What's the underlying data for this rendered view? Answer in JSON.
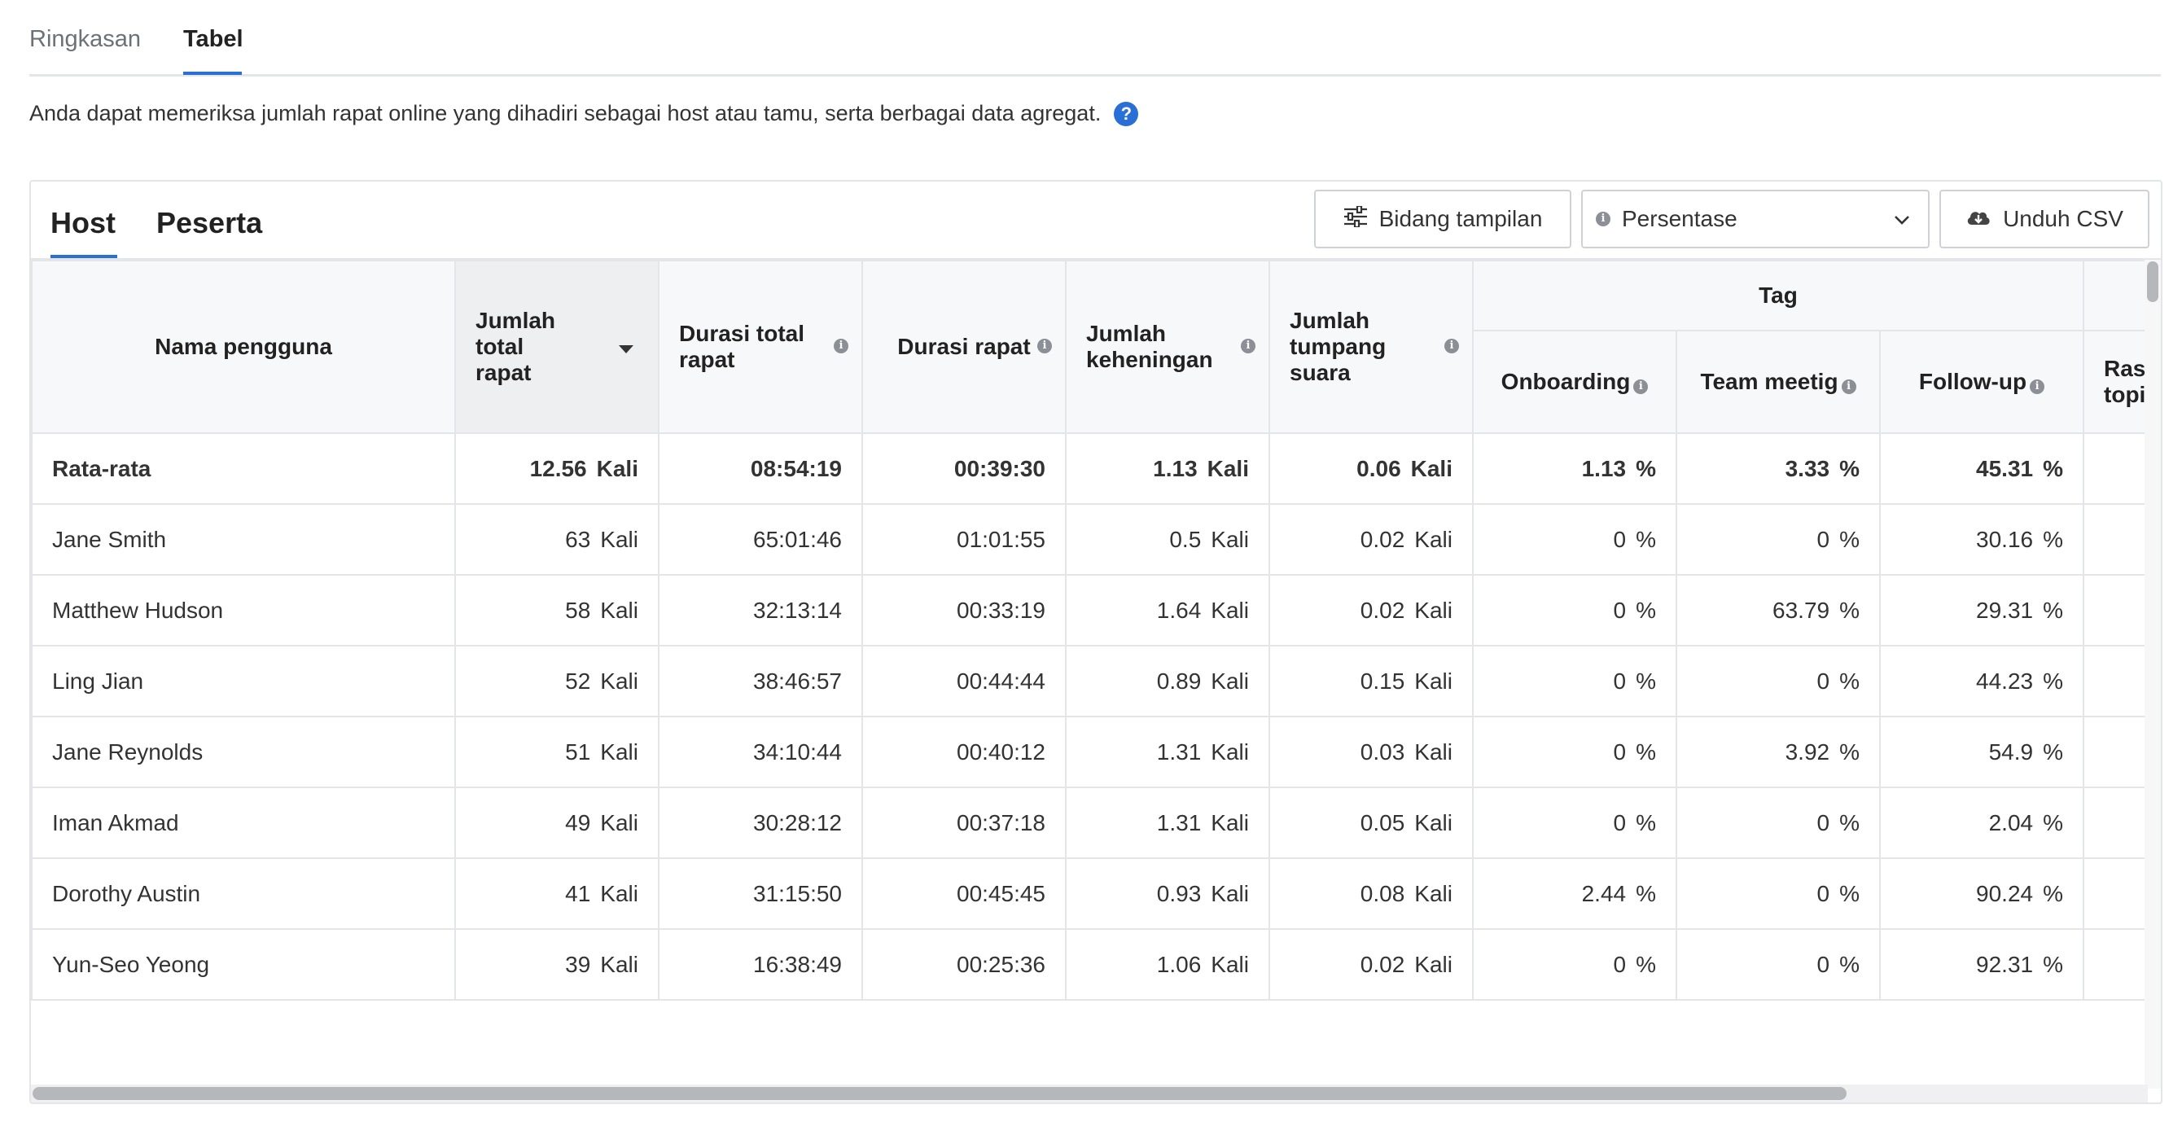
{
  "top_tabs": [
    "Ringkasan",
    "Tabel"
  ],
  "description": "Anda dapat memeriksa jumlah rapat online yang dihadiri sebagai host atau tamu, serta berbagai data agregat.",
  "panel_tabs": [
    "Host",
    "Peserta"
  ],
  "toolbar": {
    "fields_label": "Bidang tampilan",
    "percent_select": "Persentase",
    "csv_label": "Unduh CSV"
  },
  "columns": {
    "name": "Nama pengguna",
    "total_meetings": "Jumlah total rapat",
    "total_duration": "Durasi total rapat",
    "meeting_duration": "Durasi rapat",
    "silence_count": "Jumlah keheningan",
    "overlap_count": "Jumlah tumpang suara",
    "tag_group": "Tag",
    "onboarding": "Onboarding",
    "team_meeting": "Team meetig",
    "follow_up": "Follow-up",
    "cut_off": "Ras topi"
  },
  "units": {
    "times": "Kali",
    "percent": "%"
  },
  "average_row": {
    "name": "Rata-rata",
    "total_meetings": "12.56",
    "total_duration": "08:54:19",
    "meeting_duration": "00:39:30",
    "silence_count": "1.13",
    "overlap_count": "0.06",
    "onboarding": "1.13",
    "team_meeting": "3.33",
    "follow_up": "45.31"
  },
  "rows": [
    {
      "name": "Jane Smith",
      "total_meetings": "63",
      "total_duration": "65:01:46",
      "meeting_duration": "01:01:55",
      "silence_count": "0.5",
      "overlap_count": "0.02",
      "onboarding": "0",
      "team_meeting": "0",
      "follow_up": "30.16"
    },
    {
      "name": "Matthew Hudson",
      "total_meetings": "58",
      "total_duration": "32:13:14",
      "meeting_duration": "00:33:19",
      "silence_count": "1.64",
      "overlap_count": "0.02",
      "onboarding": "0",
      "team_meeting": "63.79",
      "follow_up": "29.31"
    },
    {
      "name": "Ling Jian",
      "total_meetings": "52",
      "total_duration": "38:46:57",
      "meeting_duration": "00:44:44",
      "silence_count": "0.89",
      "overlap_count": "0.15",
      "onboarding": "0",
      "team_meeting": "0",
      "follow_up": "44.23"
    },
    {
      "name": "Jane Reynolds",
      "total_meetings": "51",
      "total_duration": "34:10:44",
      "meeting_duration": "00:40:12",
      "silence_count": "1.31",
      "overlap_count": "0.03",
      "onboarding": "0",
      "team_meeting": "3.92",
      "follow_up": "54.9"
    },
    {
      "name": "Iman Akmad",
      "total_meetings": "49",
      "total_duration": "30:28:12",
      "meeting_duration": "00:37:18",
      "silence_count": "1.31",
      "overlap_count": "0.05",
      "onboarding": "0",
      "team_meeting": "0",
      "follow_up": "2.04"
    },
    {
      "name": "Dorothy Austin",
      "total_meetings": "41",
      "total_duration": "31:15:50",
      "meeting_duration": "00:45:45",
      "silence_count": "0.93",
      "overlap_count": "0.08",
      "onboarding": "2.44",
      "team_meeting": "0",
      "follow_up": "90.24"
    },
    {
      "name": "Yun-Seo Yeong",
      "total_meetings": "39",
      "total_duration": "16:38:49",
      "meeting_duration": "00:25:36",
      "silence_count": "1.06",
      "overlap_count": "0.02",
      "onboarding": "0",
      "team_meeting": "0",
      "follow_up": "92.31"
    }
  ],
  "colors": {
    "accent": "#2a6fd6",
    "border": "#e4e5e8",
    "header_bg": "#f7f8fa",
    "sorted_bg": "#eeeff1"
  },
  "icons": {
    "help": "question-circle-icon",
    "fields": "sliders-icon",
    "info": "info-icon",
    "chevron": "chevron-down-icon",
    "download": "cloud-download-icon",
    "sort": "sort-desc-icon"
  }
}
